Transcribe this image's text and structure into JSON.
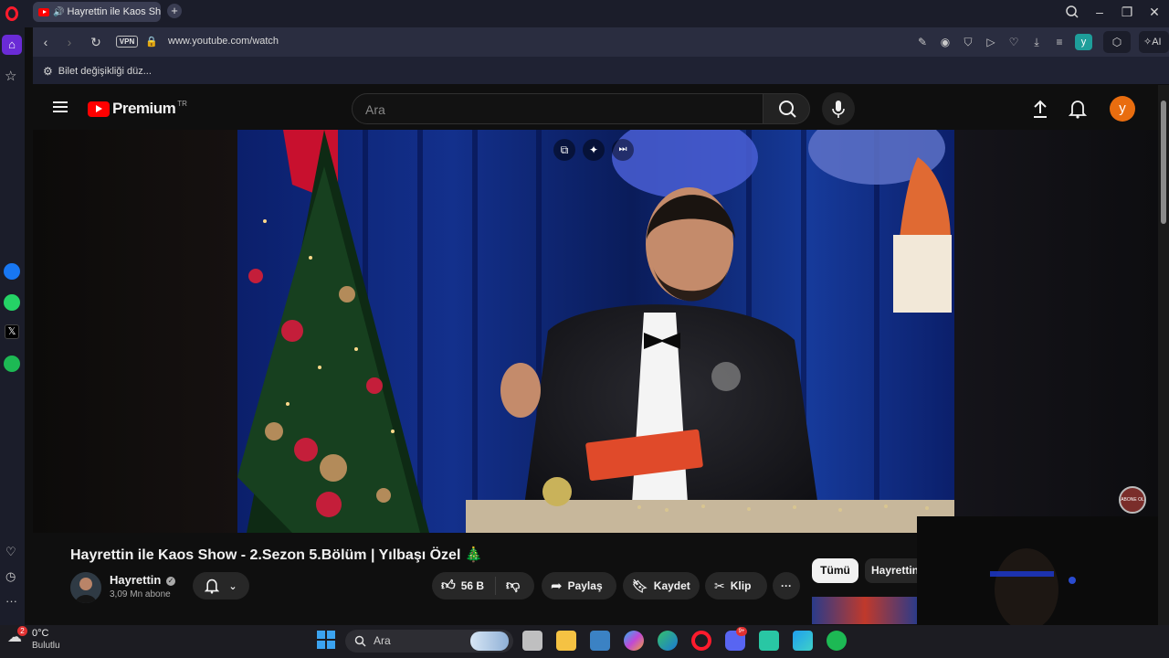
{
  "browser": {
    "tab_title": "Hayrettin ile Kaos Sho",
    "url": "www.youtube.com/watch",
    "vpn_label": "VPN",
    "bookmark_label": "Bilet değişikliği düz...",
    "ai_label": "AI",
    "ext_y_label": "y"
  },
  "youtube": {
    "logo_text": "Premium",
    "logo_region": "TR",
    "search_placeholder": "Ara",
    "avatar_letter": "y",
    "video_title": "Hayrettin ile Kaos Show - 2.Sezon 5.Bölüm | Yılbaşı Özel 🎄",
    "channel_name": "Hayrettin",
    "subscribers": "3,09 Mn abone",
    "likes": "56 B",
    "share_label": "Paylaş",
    "save_label": "Kaydet",
    "clip_label": "Klip",
    "chip_all": "Tümü",
    "chip_channel": "Hayrettin",
    "subscribe_watermark": "ABONE OL"
  },
  "taskbar": {
    "temperature": "0°C",
    "weather": "Bulutlu",
    "notification_count": "2",
    "search_label": "Ara",
    "discord_badge": "9+"
  },
  "colors": {
    "accent_red": "#ff0000",
    "avatar_orange": "#e96d0f",
    "opera_red": "#ff1b2d"
  }
}
